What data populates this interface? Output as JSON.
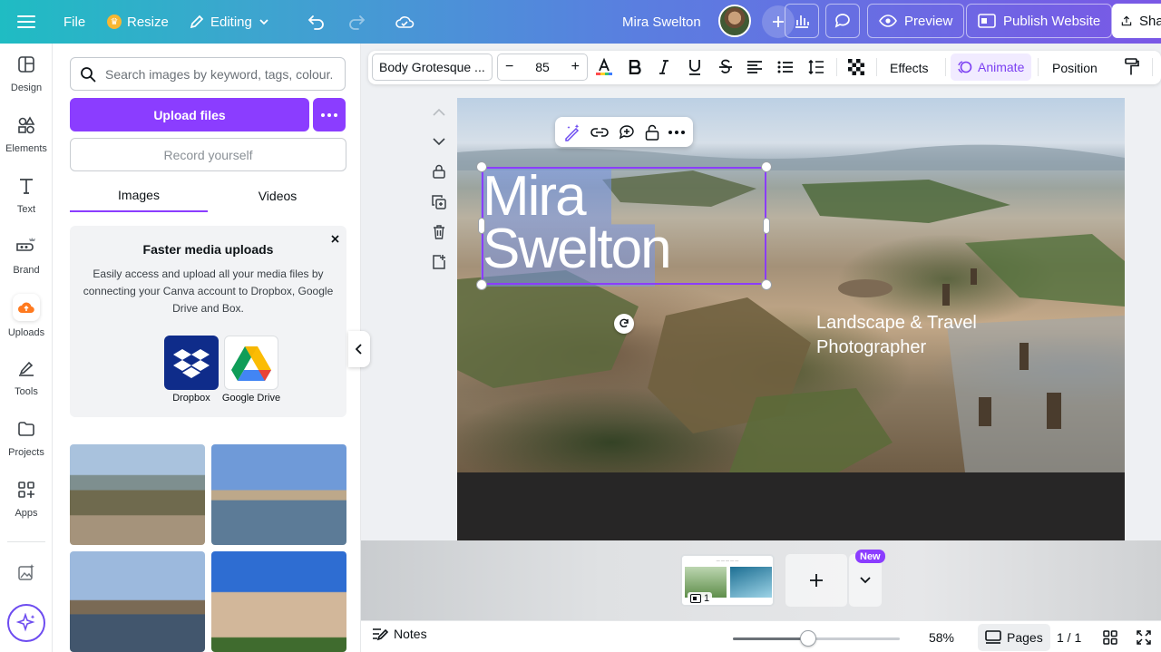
{
  "topbar": {
    "file_label": "File",
    "resize_label": "Resize",
    "editing_label": "Editing",
    "design_name": "Mira Swelton",
    "preview_label": "Preview",
    "publish_label": "Publish Website",
    "share_label": "Share"
  },
  "rail": {
    "items": [
      {
        "label": "Design"
      },
      {
        "label": "Elements"
      },
      {
        "label": "Text"
      },
      {
        "label": "Brand"
      },
      {
        "label": "Uploads"
      },
      {
        "label": "Tools"
      },
      {
        "label": "Projects"
      },
      {
        "label": "Apps"
      }
    ]
  },
  "panel": {
    "search_placeholder": "Search images by keyword, tags, colour...",
    "upload_label": "Upload files",
    "record_label": "Record yourself",
    "tabs": [
      {
        "label": "Images"
      },
      {
        "label": "Videos"
      }
    ],
    "promo": {
      "title": "Faster media uploads",
      "body": "Easily access and upload all your media files by connecting your Canva account to Dropbox, Google Drive and Box.",
      "services": [
        {
          "label": "Dropbox"
        },
        {
          "label": "Google Drive"
        }
      ]
    }
  },
  "toolbar": {
    "font": "Body Grotesque ...",
    "font_size": "85",
    "effects_label": "Effects",
    "animate_label": "Animate",
    "position_label": "Position"
  },
  "canvas": {
    "title": "Mira\nSwelton",
    "subtitle": "Landscape & Travel\nPhotographer"
  },
  "pages_strip": {
    "thumb_page_number": "1",
    "new_badge": "New"
  },
  "footer": {
    "notes_label": "Notes",
    "zoom": "58%",
    "zoom_fraction": 0.45,
    "pages_label": "Pages",
    "page_count": "1 / 1"
  },
  "colors": {
    "accent": "#8b3dff",
    "selection": "#8b3dff"
  }
}
